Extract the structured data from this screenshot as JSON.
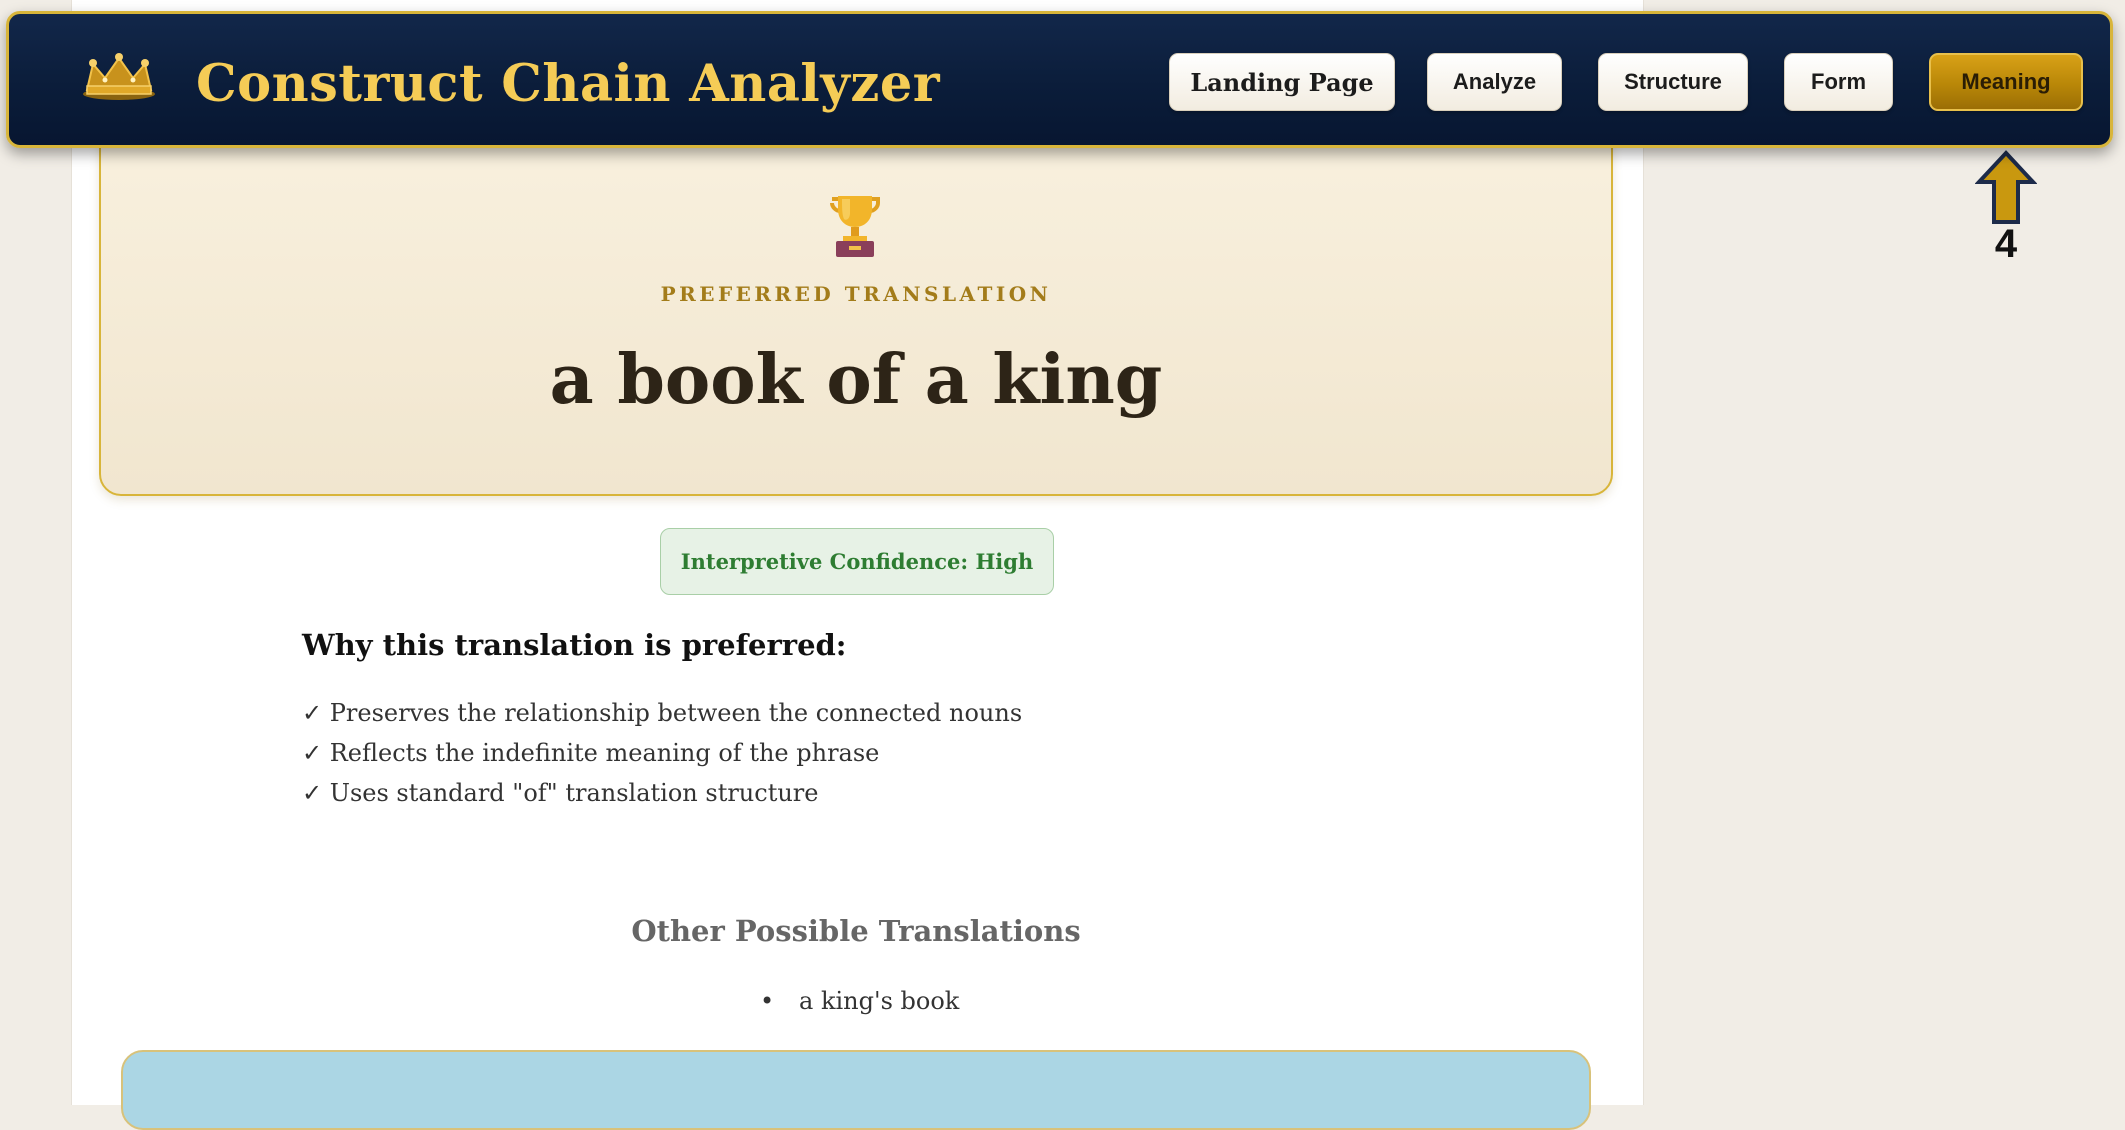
{
  "header": {
    "title": "Construct Chain Analyzer",
    "logo_icon": "crown-icon"
  },
  "nav": {
    "items": [
      {
        "label": "Landing Page",
        "active": false
      },
      {
        "label": "Analyze",
        "active": false
      },
      {
        "label": "Structure",
        "active": false
      },
      {
        "label": "Form",
        "active": false
      },
      {
        "label": "Meaning",
        "active": true
      }
    ]
  },
  "annotation": {
    "arrow_icon": "arrow-up-icon",
    "label": "4"
  },
  "hero": {
    "icon": "trophy-icon",
    "label": "PREFERRED TRANSLATION",
    "translation": "a book of a king"
  },
  "confidence": {
    "text": "Interpretive Confidence: High",
    "color": "#2e7d32"
  },
  "why": {
    "heading": "Why this translation is preferred:",
    "reasons": [
      "✓ Preserves the relationship between the connected nouns",
      "✓ Reflects the indefinite meaning of the phrase",
      "✓ Uses standard \"of\" translation structure"
    ]
  },
  "other": {
    "heading": "Other Possible Translations",
    "items": [
      "a king's book"
    ]
  },
  "colors": {
    "header_bg": "#0b1d3a",
    "accent_gold": "#d8b53a",
    "title_gold": "#f5cc56",
    "active_button": "#b98708",
    "hero_bg": "#f4ead4",
    "blue_panel": "#abd6e4"
  }
}
